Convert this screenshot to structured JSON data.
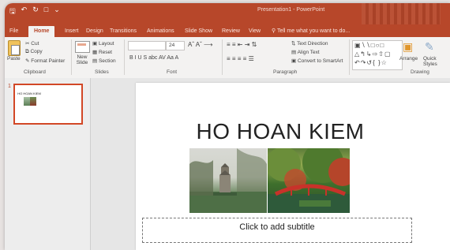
{
  "titlebar": {
    "doc_title": "Presentation1 - PowerPoint",
    "qat": [
      "save-icon",
      "undo-icon",
      "redo-icon",
      "start-from-beginning-icon",
      "customize-icon"
    ]
  },
  "tabs": [
    "File",
    "Home",
    "Insert",
    "Design",
    "Transitions",
    "Animations",
    "Slide Show",
    "Review",
    "View"
  ],
  "tell_me": "Tell me what you want to do...",
  "ribbon": {
    "clipboard": {
      "paste": "Paste",
      "cut": "Cut",
      "copy": "Copy",
      "format_painter": "Format Painter",
      "label": "Clipboard"
    },
    "slides": {
      "new_slide": "New Slide",
      "layout": "Layout",
      "reset": "Reset",
      "section": "Section",
      "label": "Slides"
    },
    "font": {
      "size": "24",
      "label": "Font",
      "format_row": "B   I   U   S   abc   AV   Aa   A"
    },
    "paragraph": {
      "text_direction": "Text Direction",
      "align_text": "Align Text",
      "convert_smartart": "Convert to SmartArt",
      "label": "Paragraph"
    },
    "drawing": {
      "arrange": "Arrange",
      "quick_styles": "Quick Styles",
      "label": "Drawing"
    }
  },
  "thumbnails": [
    {
      "number": "1",
      "title": "HO HOAN KIEM"
    }
  ],
  "slide": {
    "title": "HO HOAN KIEM",
    "subtitle_placeholder": "Click to add subtitle"
  },
  "colors": {
    "accent": "#b7472a",
    "selection": "#d24726"
  }
}
